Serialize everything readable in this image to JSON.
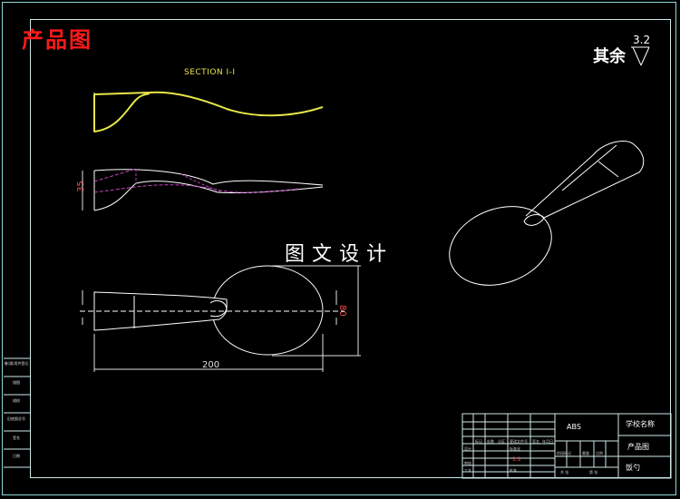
{
  "product_tag": "产品图",
  "section_title": "SECTION I-I",
  "design_watermark": "图文设计",
  "roughness": {
    "label": "其余",
    "value": "3.2"
  },
  "dimensions": {
    "length": "200",
    "width": "80",
    "height": "35"
  },
  "side_table": {
    "cells": [
      "借(通)用件登记",
      "描图",
      "描校",
      "旧底图总号",
      "签名",
      "日期"
    ]
  },
  "title_block": {
    "material": "ABS",
    "school": "学校名称",
    "drawing_type": "产品图",
    "part_name": "饭勺",
    "scale_value": "1:1",
    "small_labels": [
      "标记",
      "处数",
      "分区",
      "更改文件号",
      "签名",
      "年月日",
      "设计",
      "标准化",
      "阶段标记",
      "重量",
      "比例",
      "审核",
      "工艺",
      "批准",
      "共 张",
      "第 张"
    ]
  },
  "colors": {
    "frame": "#8fd7d7",
    "outline": "#ffffff",
    "section_line": "#e6e64a",
    "hidden_line": "#c040c0",
    "dimension": "#ff4a4a",
    "center_line": "#ffffff",
    "brand": "#ff1a1a"
  }
}
